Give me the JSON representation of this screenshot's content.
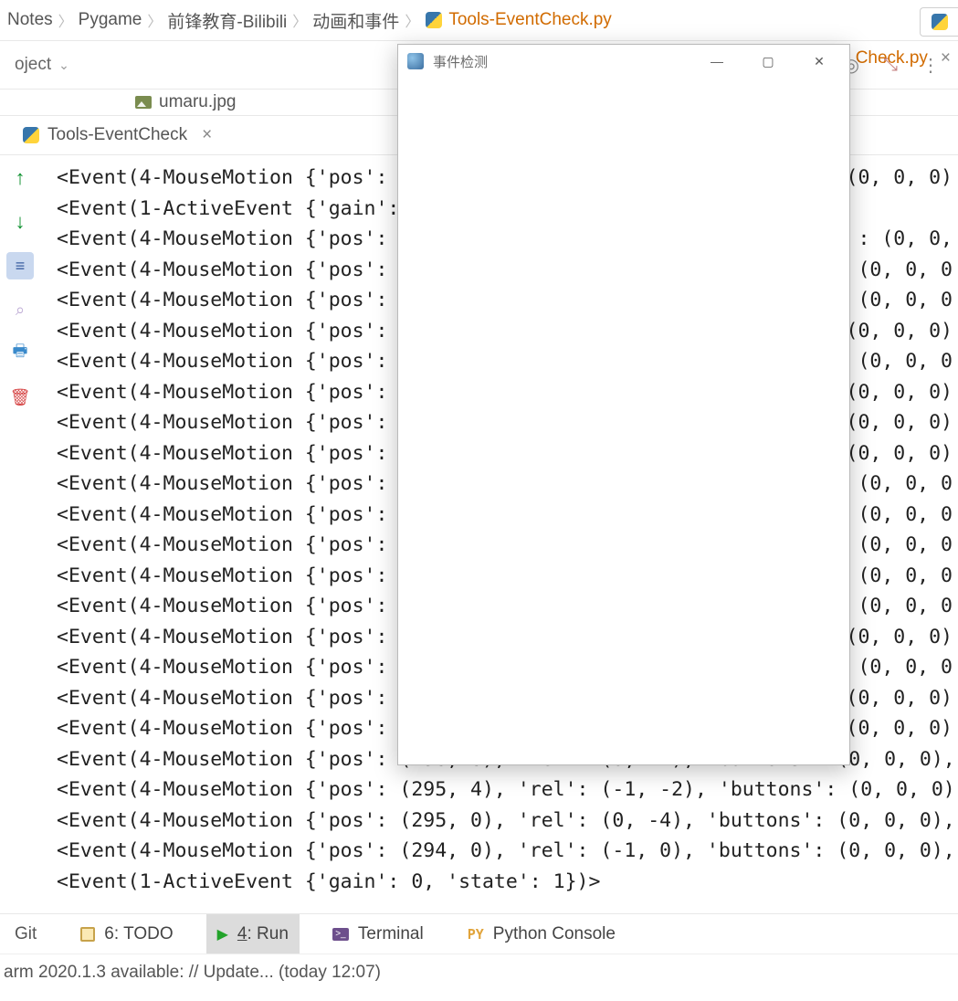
{
  "breadcrumbs": {
    "items": [
      "Notes",
      "Pygame",
      "前锋教育-Bilibili",
      "动画和事件"
    ],
    "active": "Tools-EventCheck.py"
  },
  "project_label": "oject",
  "editor_tab_right": "Check.py",
  "file_pill": "umaru.jpg",
  "run_tab": "Tools-EventCheck",
  "console_lines": [
    {
      "lhs": "<Event(4-MouseMotion {'pos':",
      "rhs": "(0, 0, 0)"
    },
    {
      "lhs": "<Event(1-ActiveEvent {'gain':",
      "rhs": ""
    },
    {
      "lhs": "<Event(4-MouseMotion {'pos':",
      "rhs": ": (0, 0,"
    },
    {
      "lhs": "<Event(4-MouseMotion {'pos':",
      "rhs": " (0, 0, 0"
    },
    {
      "lhs": "<Event(4-MouseMotion {'pos':",
      "rhs": " (0, 0, 0"
    },
    {
      "lhs": "<Event(4-MouseMotion {'pos':",
      "rhs": "(0, 0, 0)"
    },
    {
      "lhs": "<Event(4-MouseMotion {'pos':",
      "rhs": " (0, 0, 0"
    },
    {
      "lhs": "<Event(4-MouseMotion {'pos':",
      "rhs": "(0, 0, 0)"
    },
    {
      "lhs": "<Event(4-MouseMotion {'pos':",
      "rhs": "(0, 0, 0)"
    },
    {
      "lhs": "<Event(4-MouseMotion {'pos':",
      "rhs": "(0, 0, 0)"
    },
    {
      "lhs": "<Event(4-MouseMotion {'pos':",
      "rhs": " (0, 0, 0"
    },
    {
      "lhs": "<Event(4-MouseMotion {'pos':",
      "rhs": " (0, 0, 0"
    },
    {
      "lhs": "<Event(4-MouseMotion {'pos':",
      "rhs": " (0, 0, 0"
    },
    {
      "lhs": "<Event(4-MouseMotion {'pos':",
      "rhs": " (0, 0, 0"
    },
    {
      "lhs": "<Event(4-MouseMotion {'pos':",
      "rhs": " (0, 0, 0"
    },
    {
      "lhs": "<Event(4-MouseMotion {'pos':",
      "rhs": "(0, 0, 0)"
    },
    {
      "lhs": "<Event(4-MouseMotion {'pos':",
      "rhs": " (0, 0, 0"
    },
    {
      "lhs": "<Event(4-MouseMotion {'pos':",
      "rhs": "(0, 0, 0)"
    },
    {
      "lhs": "<Event(4-MouseMotion {'pos':",
      "rhs": "(0, 0, 0)"
    },
    {
      "full": "<Event(4-MouseMotion {'pos': (296, 6), 'rel': (0, -2), 'buttons': (0, 0, 0),"
    },
    {
      "full": "<Event(4-MouseMotion {'pos': (295, 4), 'rel': (-1, -2), 'buttons': (0, 0, 0)"
    },
    {
      "full": "<Event(4-MouseMotion {'pos': (295, 0), 'rel': (0, -4), 'buttons': (0, 0, 0),"
    },
    {
      "full": "<Event(4-MouseMotion {'pos': (294, 0), 'rel': (-1, 0), 'buttons': (0, 0, 0),"
    },
    {
      "full": "<Event(1-ActiveEvent {'gain': 0, 'state': 1})>"
    }
  ],
  "tool_windows": {
    "git": "Git",
    "todo": "6: TODO",
    "run": "4: Run",
    "terminal": "Terminal",
    "pyconsole": "Python Console"
  },
  "status_line": "arm 2020.1.3 available: // Update... (today 12:07)",
  "pygame_window": {
    "title": "事件检测"
  }
}
